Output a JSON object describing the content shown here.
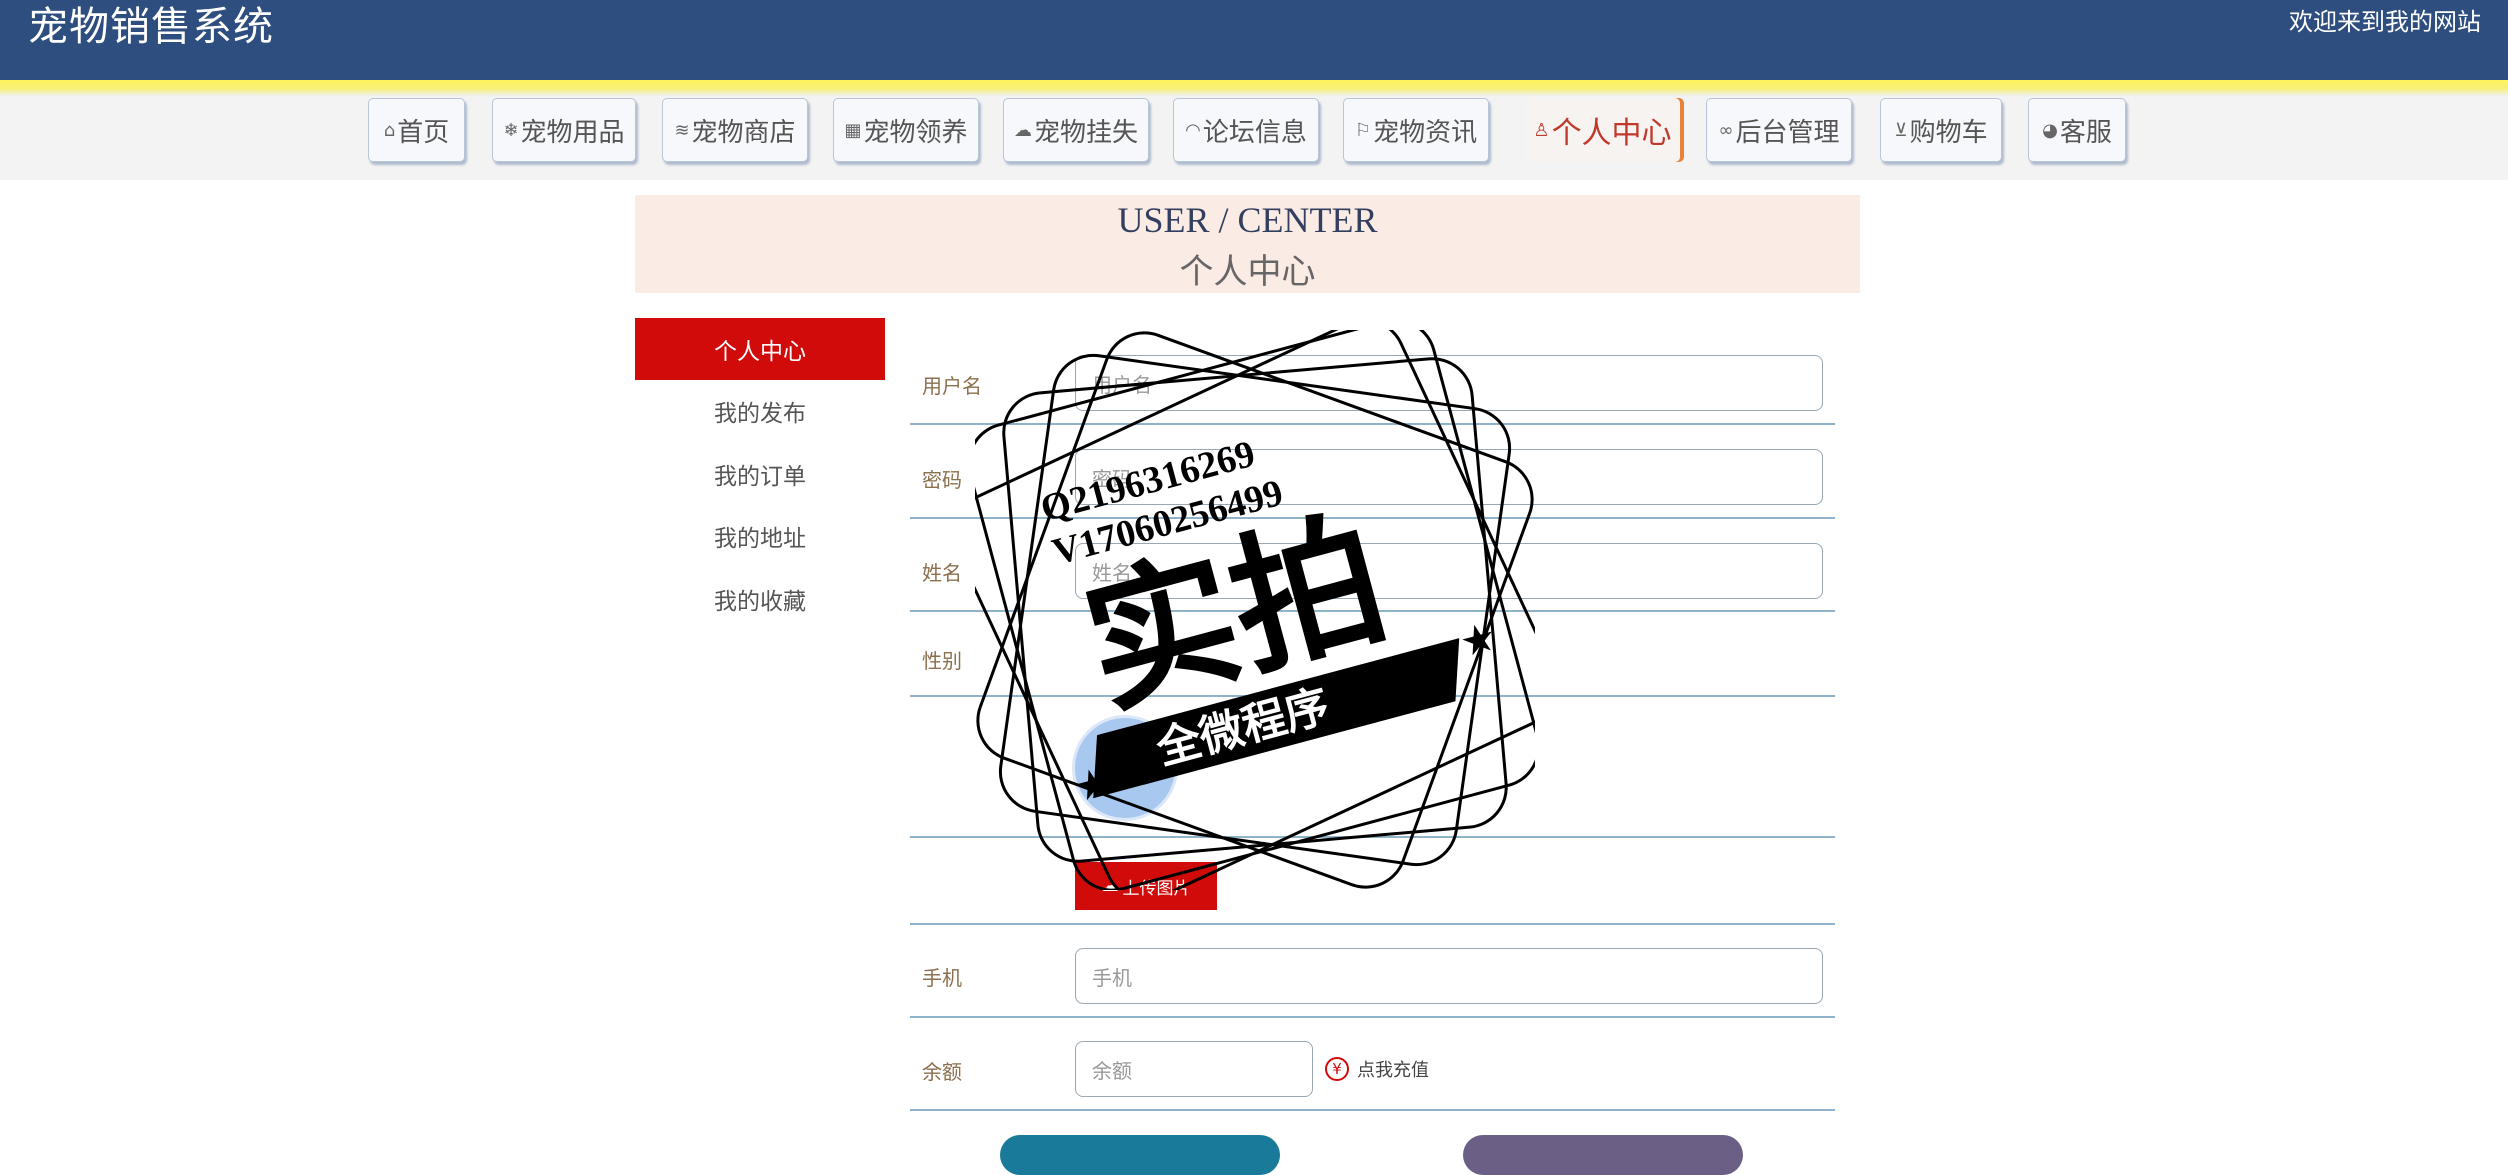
{
  "header": {
    "site_title": "宠物销售系统",
    "welcome": "欢迎来到我的网站"
  },
  "nav": {
    "items": [
      {
        "label": "首页",
        "icon": "home-icon",
        "glyph": "⌂"
      },
      {
        "label": "宠物用品",
        "icon": "snowflake-icon",
        "glyph": "❄"
      },
      {
        "label": "宠物商店",
        "icon": "layers-icon",
        "glyph": "≋"
      },
      {
        "label": "宠物领养",
        "icon": "calendar-icon",
        "glyph": "▦"
      },
      {
        "label": "宠物挂失",
        "icon": "chat-icon",
        "glyph": "☁"
      },
      {
        "label": "论坛信息",
        "icon": "gauge-icon",
        "glyph": "◠"
      },
      {
        "label": "宠物资讯",
        "icon": "flag-icon",
        "glyph": "⚐"
      },
      {
        "label": "个人中心",
        "icon": "user-icon",
        "glyph": "♙",
        "active": true
      },
      {
        "label": "后台管理",
        "icon": "link-icon",
        "glyph": "∞"
      },
      {
        "label": "购物车",
        "icon": "cart-icon",
        "glyph": "⊻"
      },
      {
        "label": "客服",
        "icon": "service-icon",
        "glyph": "◕"
      }
    ]
  },
  "banner": {
    "title_en": "USER / CENTER",
    "title_zh": "个人中心"
  },
  "sidebar": {
    "items": [
      {
        "label": "个人中心",
        "active": true
      },
      {
        "label": "我的发布"
      },
      {
        "label": "我的订单"
      },
      {
        "label": "我的地址"
      },
      {
        "label": "我的收藏"
      }
    ]
  },
  "form": {
    "username": {
      "label": "用户名",
      "placeholder": "用户名"
    },
    "password": {
      "label": "密码",
      "placeholder": "密码"
    },
    "name": {
      "label": "姓名",
      "placeholder": "姓名"
    },
    "gender": {
      "label": "性别"
    },
    "upload_label": "上传图片",
    "phone": {
      "label": "手机",
      "placeholder": "手机"
    },
    "balance": {
      "label": "余额",
      "placeholder": "余额"
    },
    "recharge_label": "点我充值",
    "recharge_symbol": "¥"
  },
  "watermark": {
    "line1": "Q2196316269",
    "line2": "V17060256499",
    "big_text": "实拍",
    "banner_text": "全微程序"
  },
  "colors": {
    "header_bg": "#2d4e7e",
    "accent_red": "#d10a0a",
    "banner_bg": "#fbebe5",
    "active_nav_border": "#e8823a"
  }
}
